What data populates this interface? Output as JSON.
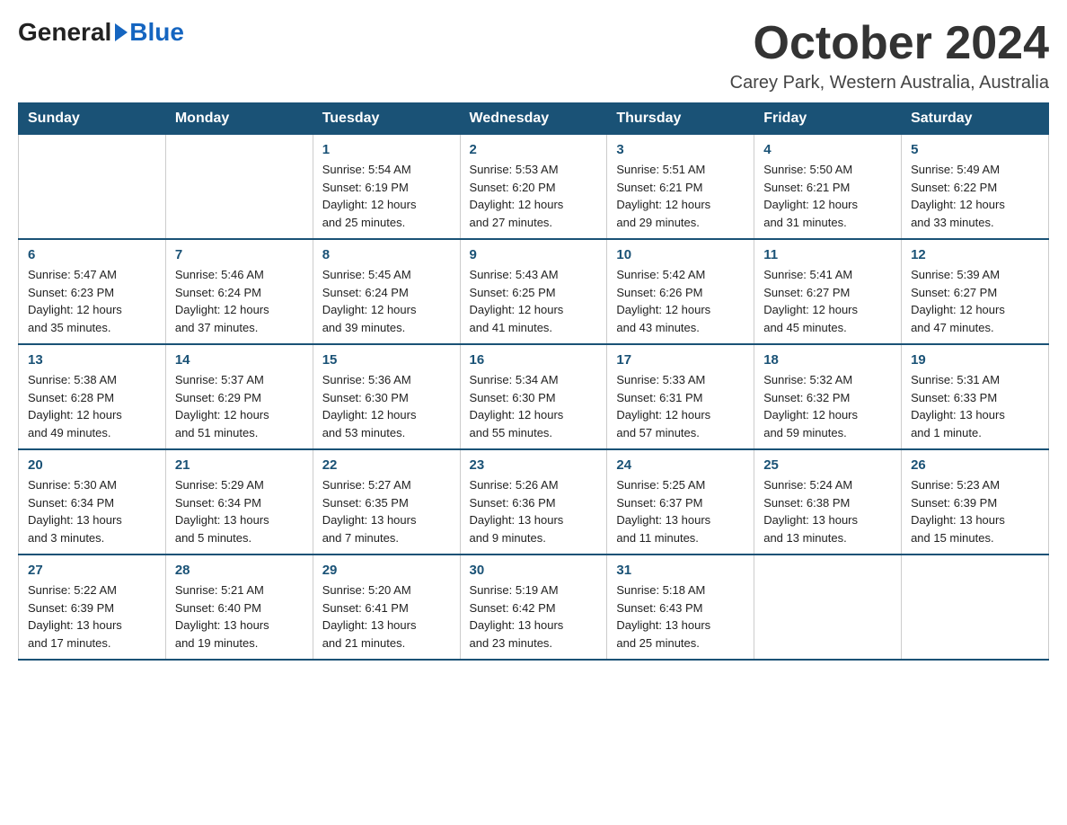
{
  "header": {
    "logo_general": "General",
    "logo_blue": "Blue",
    "month_title": "October 2024",
    "subtitle": "Carey Park, Western Australia, Australia"
  },
  "weekdays": [
    "Sunday",
    "Monday",
    "Tuesday",
    "Wednesday",
    "Thursday",
    "Friday",
    "Saturday"
  ],
  "weeks": [
    [
      {
        "day": "",
        "detail": ""
      },
      {
        "day": "",
        "detail": ""
      },
      {
        "day": "1",
        "detail": "Sunrise: 5:54 AM\nSunset: 6:19 PM\nDaylight: 12 hours\nand 25 minutes."
      },
      {
        "day": "2",
        "detail": "Sunrise: 5:53 AM\nSunset: 6:20 PM\nDaylight: 12 hours\nand 27 minutes."
      },
      {
        "day": "3",
        "detail": "Sunrise: 5:51 AM\nSunset: 6:21 PM\nDaylight: 12 hours\nand 29 minutes."
      },
      {
        "day": "4",
        "detail": "Sunrise: 5:50 AM\nSunset: 6:21 PM\nDaylight: 12 hours\nand 31 minutes."
      },
      {
        "day": "5",
        "detail": "Sunrise: 5:49 AM\nSunset: 6:22 PM\nDaylight: 12 hours\nand 33 minutes."
      }
    ],
    [
      {
        "day": "6",
        "detail": "Sunrise: 5:47 AM\nSunset: 6:23 PM\nDaylight: 12 hours\nand 35 minutes."
      },
      {
        "day": "7",
        "detail": "Sunrise: 5:46 AM\nSunset: 6:24 PM\nDaylight: 12 hours\nand 37 minutes."
      },
      {
        "day": "8",
        "detail": "Sunrise: 5:45 AM\nSunset: 6:24 PM\nDaylight: 12 hours\nand 39 minutes."
      },
      {
        "day": "9",
        "detail": "Sunrise: 5:43 AM\nSunset: 6:25 PM\nDaylight: 12 hours\nand 41 minutes."
      },
      {
        "day": "10",
        "detail": "Sunrise: 5:42 AM\nSunset: 6:26 PM\nDaylight: 12 hours\nand 43 minutes."
      },
      {
        "day": "11",
        "detail": "Sunrise: 5:41 AM\nSunset: 6:27 PM\nDaylight: 12 hours\nand 45 minutes."
      },
      {
        "day": "12",
        "detail": "Sunrise: 5:39 AM\nSunset: 6:27 PM\nDaylight: 12 hours\nand 47 minutes."
      }
    ],
    [
      {
        "day": "13",
        "detail": "Sunrise: 5:38 AM\nSunset: 6:28 PM\nDaylight: 12 hours\nand 49 minutes."
      },
      {
        "day": "14",
        "detail": "Sunrise: 5:37 AM\nSunset: 6:29 PM\nDaylight: 12 hours\nand 51 minutes."
      },
      {
        "day": "15",
        "detail": "Sunrise: 5:36 AM\nSunset: 6:30 PM\nDaylight: 12 hours\nand 53 minutes."
      },
      {
        "day": "16",
        "detail": "Sunrise: 5:34 AM\nSunset: 6:30 PM\nDaylight: 12 hours\nand 55 minutes."
      },
      {
        "day": "17",
        "detail": "Sunrise: 5:33 AM\nSunset: 6:31 PM\nDaylight: 12 hours\nand 57 minutes."
      },
      {
        "day": "18",
        "detail": "Sunrise: 5:32 AM\nSunset: 6:32 PM\nDaylight: 12 hours\nand 59 minutes."
      },
      {
        "day": "19",
        "detail": "Sunrise: 5:31 AM\nSunset: 6:33 PM\nDaylight: 13 hours\nand 1 minute."
      }
    ],
    [
      {
        "day": "20",
        "detail": "Sunrise: 5:30 AM\nSunset: 6:34 PM\nDaylight: 13 hours\nand 3 minutes."
      },
      {
        "day": "21",
        "detail": "Sunrise: 5:29 AM\nSunset: 6:34 PM\nDaylight: 13 hours\nand 5 minutes."
      },
      {
        "day": "22",
        "detail": "Sunrise: 5:27 AM\nSunset: 6:35 PM\nDaylight: 13 hours\nand 7 minutes."
      },
      {
        "day": "23",
        "detail": "Sunrise: 5:26 AM\nSunset: 6:36 PM\nDaylight: 13 hours\nand 9 minutes."
      },
      {
        "day": "24",
        "detail": "Sunrise: 5:25 AM\nSunset: 6:37 PM\nDaylight: 13 hours\nand 11 minutes."
      },
      {
        "day": "25",
        "detail": "Sunrise: 5:24 AM\nSunset: 6:38 PM\nDaylight: 13 hours\nand 13 minutes."
      },
      {
        "day": "26",
        "detail": "Sunrise: 5:23 AM\nSunset: 6:39 PM\nDaylight: 13 hours\nand 15 minutes."
      }
    ],
    [
      {
        "day": "27",
        "detail": "Sunrise: 5:22 AM\nSunset: 6:39 PM\nDaylight: 13 hours\nand 17 minutes."
      },
      {
        "day": "28",
        "detail": "Sunrise: 5:21 AM\nSunset: 6:40 PM\nDaylight: 13 hours\nand 19 minutes."
      },
      {
        "day": "29",
        "detail": "Sunrise: 5:20 AM\nSunset: 6:41 PM\nDaylight: 13 hours\nand 21 minutes."
      },
      {
        "day": "30",
        "detail": "Sunrise: 5:19 AM\nSunset: 6:42 PM\nDaylight: 13 hours\nand 23 minutes."
      },
      {
        "day": "31",
        "detail": "Sunrise: 5:18 AM\nSunset: 6:43 PM\nDaylight: 13 hours\nand 25 minutes."
      },
      {
        "day": "",
        "detail": ""
      },
      {
        "day": "",
        "detail": ""
      }
    ]
  ]
}
